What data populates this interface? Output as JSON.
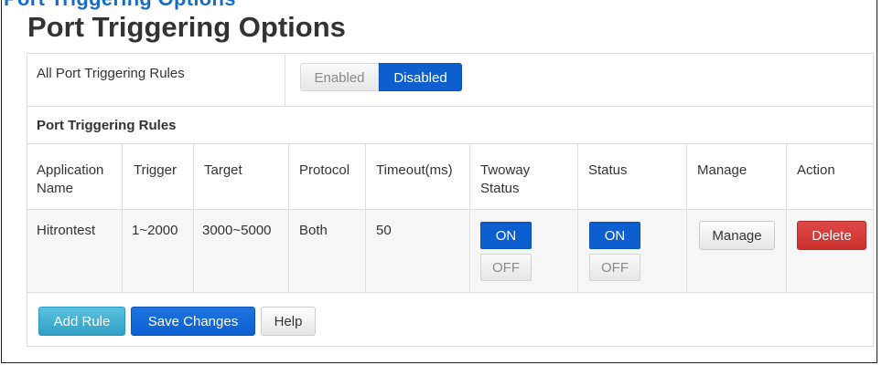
{
  "page": {
    "title_cut": "Port Triggering Options",
    "title": "Port Triggering Options"
  },
  "all_rules": {
    "label": "All Port Triggering Rules",
    "enabled_label": "Enabled",
    "disabled_label": "Disabled",
    "selected": "Disabled"
  },
  "rules_section": {
    "title": "Port Triggering Rules",
    "columns": {
      "app_name": "Application Name",
      "app_name_l1": "Application",
      "app_name_l2": "Name",
      "trigger": "Trigger",
      "target": "Target",
      "protocol": "Protocol",
      "timeout": "Timeout(ms)",
      "twoway_l1": "Twoway",
      "twoway_l2": "Status",
      "status": "Status",
      "manage": "Manage",
      "action": "Action"
    },
    "rows": [
      {
        "app_name": "Hitrontest",
        "trigger": "1~2000",
        "target": "3000~5000",
        "protocol": "Both",
        "timeout": "50",
        "twoway_on": "ON",
        "twoway_off": "OFF",
        "twoway_state": "ON",
        "status_on": "ON",
        "status_off": "OFF",
        "status_state": "ON",
        "manage_label": "Manage",
        "delete_label": "Delete"
      }
    ]
  },
  "footer": {
    "add_rule": "Add Rule",
    "save_changes": "Save Changes",
    "help": "Help"
  },
  "colors": {
    "primary": "#0d5fd0",
    "info": "#31a0c5",
    "danger": "#c9302c",
    "title_blue": "#1a6ec2"
  }
}
